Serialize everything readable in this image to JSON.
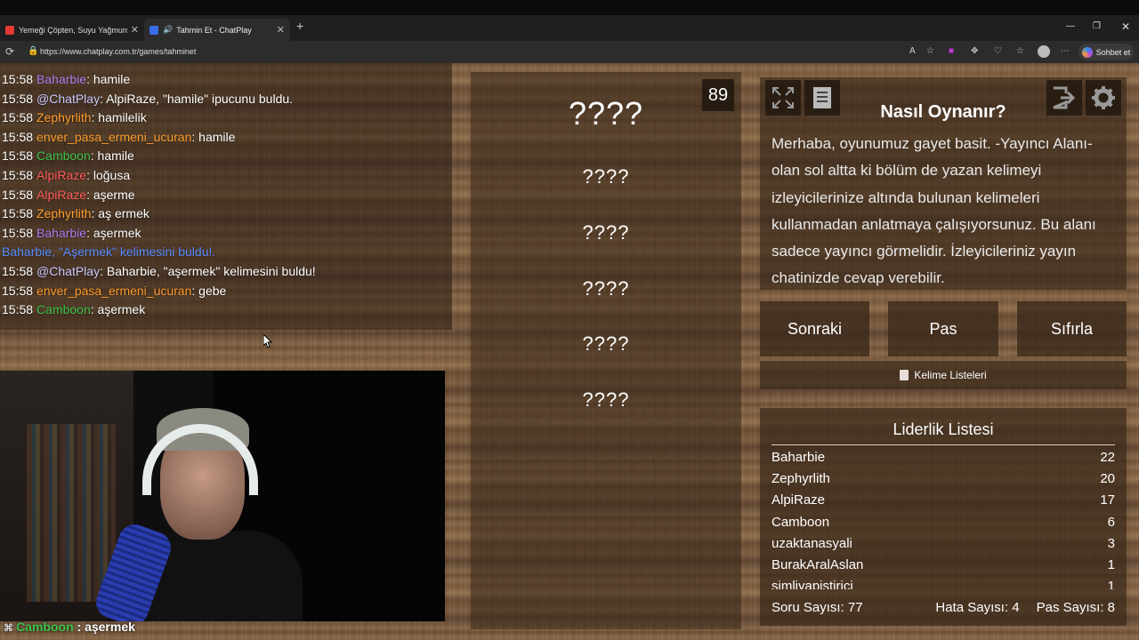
{
  "browser": {
    "tabs": [
      {
        "title": "Yemeği Çöpten, Suyu Yağmurdan...",
        "favicon_color": "#e53935"
      },
      {
        "title": "Tahmin Et - ChatPlay",
        "favicon_color": "#3a6ee8"
      }
    ],
    "url": "https://www.chatplay.com.tr/games/tahminet",
    "copilot_label": "Sohbet et"
  },
  "chat": {
    "lines": [
      {
        "time": "15:58",
        "user": "Baharbie",
        "color": "#b67cf0",
        "text": ": hamile"
      },
      {
        "time": "15:58",
        "user": "@ChatPlay",
        "color": "#c9c9ff",
        "text": ": AlpiRaze, \"hamile\" ipucunu buldu."
      },
      {
        "time": "15:58",
        "user": "Zephyrlith",
        "color": "#ff9d2e",
        "text": ": hamilelik"
      },
      {
        "time": "15:58",
        "user": "enver_pasa_ermeni_ucuran",
        "color": "#ff9d2e",
        "text": ": hamile"
      },
      {
        "time": "15:58",
        "user": "Camboon",
        "color": "#3ec24a",
        "text": ": hamile"
      },
      {
        "time": "15:58",
        "user": "AlpiRaze",
        "color": "#ff5c5c",
        "text": ": loğusa"
      },
      {
        "time": "15:58",
        "user": "AlpiRaze",
        "color": "#ff5c5c",
        "text": ": aşerme"
      },
      {
        "time": "15:58",
        "user": "Zephyrlith",
        "color": "#ff9d2e",
        "text": ": aş ermek"
      },
      {
        "time": "15:58",
        "user": "Baharbie",
        "color": "#b67cf0",
        "text": ": aşermek"
      },
      {
        "time": "",
        "user": "Baharbie, \"Aşermek\" kelimesini buldu!.",
        "color": "#5a8cff",
        "text": ""
      },
      {
        "time": "15:58",
        "user": "@ChatPlay",
        "color": "#c9c9ff",
        "text": ": Baharbie, \"aşermek\" kelimesini buldu!"
      },
      {
        "time": "15:58",
        "user": "enver_pasa_ermeni_ucuran",
        "color": "#ff9d2e",
        "text": ": gebe"
      },
      {
        "time": "15:58",
        "user": "Camboon",
        "color": "#3ec24a",
        "text": ": aşermek"
      }
    ]
  },
  "overlay": {
    "user": "Camboon",
    "text": " : aşermek"
  },
  "game": {
    "timer": "89",
    "main_word": "????",
    "hidden_words": [
      "????",
      "????",
      "????",
      "????",
      "????"
    ]
  },
  "howto": {
    "title": "Nasıl Oynanır?",
    "text": "Merhaba, oyunumuz gayet basit. -Yayıncı Alanı- olan sol altta ki bölüm de yazan kelimeyi izleyicilerinize altında bulunan kelimeleri kullanmadan anlatmaya çalışıyorsunuz. Bu alanı sadece yayıncı görmelidir. İzleyicileriniz yayın chatinizde cevap verebilir."
  },
  "controls": {
    "next": "Sonraki",
    "pass": "Pas",
    "reset": "Sıfırla",
    "word_lists": "Kelime Listeleri"
  },
  "leaderboard": {
    "title": "Liderlik Listesi",
    "rows": [
      {
        "name": "Baharbie",
        "score": "22"
      },
      {
        "name": "Zephyrlith",
        "score": "20"
      },
      {
        "name": "AlpiRaze",
        "score": "17"
      },
      {
        "name": "Camboon",
        "score": "6"
      },
      {
        "name": "uzaktanasyali",
        "score": "3"
      },
      {
        "name": "BurakAralAslan",
        "score": "1"
      },
      {
        "name": "simliyapistirici",
        "score": "1"
      }
    ],
    "question_count": "Soru Sayısı: 77",
    "error_count": "Hata Sayısı: 4",
    "pass_count": "Pas Sayısı: 8"
  }
}
